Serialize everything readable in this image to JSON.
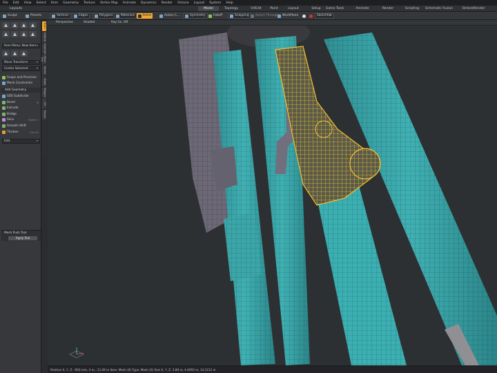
{
  "menubar": {
    "items": [
      "File",
      "Edit",
      "View",
      "Select",
      "Item",
      "Geometry",
      "Texture",
      "Vertex Map",
      "Animate",
      "Dynamics",
      "Render",
      "Octane",
      "Layout",
      "System",
      "Help"
    ]
  },
  "layout_tabs": {
    "label": "Layouts",
    "tabs": [
      {
        "label": "Model",
        "active": true
      },
      {
        "label": "Topology",
        "active": false
      },
      {
        "label": "UVEdit",
        "active": false
      },
      {
        "label": "Paint",
        "active": false
      },
      {
        "label": "Layout",
        "active": false
      },
      {
        "label": "Setup",
        "active": false
      },
      {
        "label": "Game Tools",
        "active": false
      },
      {
        "label": "Animate",
        "active": false
      },
      {
        "label": "Render",
        "active": false
      },
      {
        "label": "Scripting",
        "active": false
      },
      {
        "label": "Schematic Fusion",
        "active": false
      },
      {
        "label": "OctaneRender",
        "active": false
      }
    ]
  },
  "toolbar": {
    "sculpt": "Sculpt",
    "presets": "Presets",
    "vertices": "Vertices",
    "edges": "Edges",
    "polygons": "Polygons",
    "materials": "Materials",
    "items": "Items",
    "action_center": "Action C...",
    "symmetry": "Symmetry",
    "falloff": "Falloff",
    "snapping": "Snapping",
    "select_through": "Select Through",
    "workplane": "WorkPlane",
    "sketchfab": "Sketchfab"
  },
  "vertical_tabs": [
    "Basic",
    "Deform",
    "Duplicate",
    "Mesh Edit",
    "Vertex",
    "Edge",
    "Polygon",
    "UV",
    "Fusion"
  ],
  "left_panel": {
    "item_menu": "Item Menu: New Item",
    "move_transform": "Move Transform",
    "center_selected": "Center Selected",
    "snaps": "Snaps and Precision",
    "mesh_constraints": "Mesh Constraints",
    "add_geometry": "Add Geometry",
    "tools": [
      {
        "label": "SDS Subdivide",
        "shortcut": "",
        "color": "#6fa7d6"
      },
      {
        "label": "Bevel",
        "shortcut": "B",
        "color": "#7fb36f"
      },
      {
        "label": "Extrude",
        "shortcut": "",
        "color": "#7fb36f"
      },
      {
        "label": "Bridge",
        "shortcut": "",
        "color": "#7fb36f"
      },
      {
        "label": "Slice",
        "shortcut": "Shift+C",
        "color": "#c98bd1"
      },
      {
        "label": "Smooth Shift",
        "shortcut": "",
        "color": "#7fb36f"
      },
      {
        "label": "Thicken",
        "shortcut": "Ctrl+D",
        "color": "#e0a040"
      }
    ],
    "edit": "Edit",
    "mesh_push_tool": "Mesh Push Tool",
    "apply_tool": "Apply Tool"
  },
  "viewport": {
    "view": "Perspective",
    "shading": "Shaded",
    "ray_gl": "Ray GL: Off"
  },
  "status_bar": {
    "text": "Position X, Y, Z: -950 mm, 4 m, -11.09 m   Item: Mesh (0)   Type: Mesh (0)   Size X, Y, Z: 3.89 m, 4.4955 m, 14.2212 m"
  },
  "colors": {
    "accent": "#f1a82f",
    "model_teal": "#36a5a8",
    "selection_yellow": "#f3c232",
    "model_grey": "#6e6a78",
    "background": "#2d3033"
  }
}
